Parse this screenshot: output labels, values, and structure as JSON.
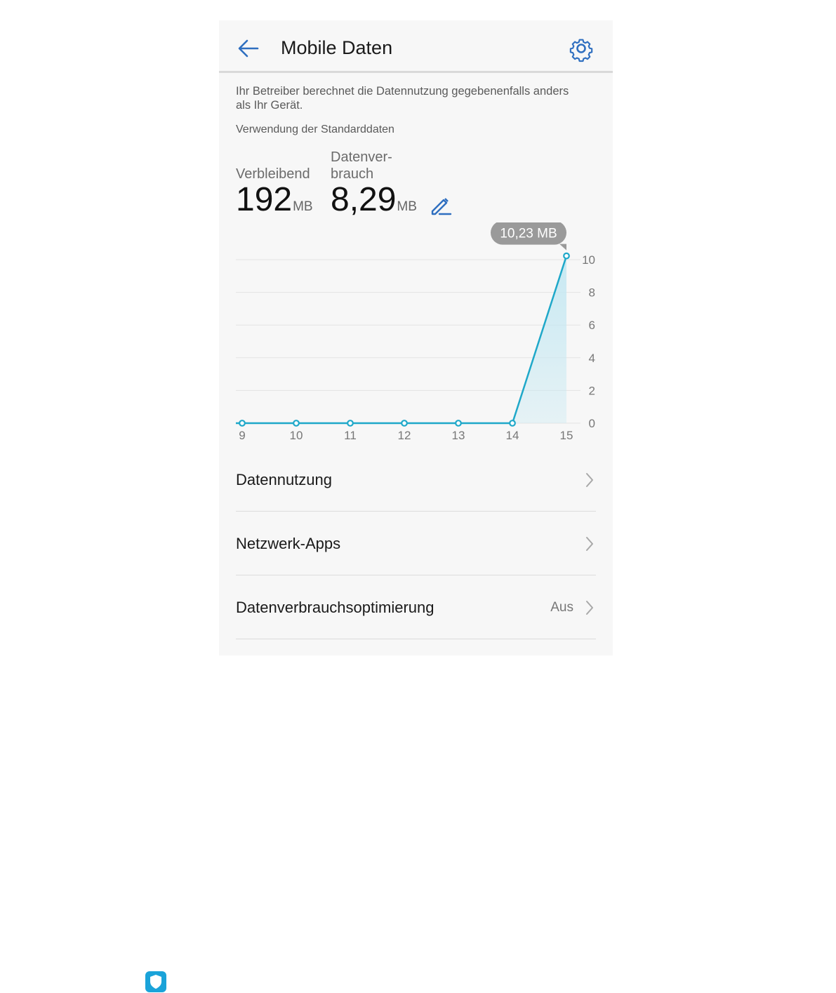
{
  "header": {
    "title": "Mobile Daten",
    "back_icon": "arrow-left-icon",
    "settings_icon": "gear-icon",
    "accent_color": "#2f6fc0"
  },
  "notice": {
    "text": "Ihr Betreiber berechnet die Datennutzung gegebenenfalls anders als Ihr Gerät.",
    "subtitle": "Verwendung der Standarddaten"
  },
  "stats": {
    "remaining_label": "Verbleibend",
    "remaining_value": "192",
    "remaining_unit": "MB",
    "usage_label_line1": "Datenver-",
    "usage_label_line2": "brauch",
    "usage_value": "8,29",
    "usage_unit": "MB",
    "edit_icon": "pencil-edit-icon"
  },
  "chart_data": {
    "type": "area",
    "x": [
      "9",
      "10",
      "11",
      "12",
      "13",
      "14",
      "15"
    ],
    "values": [
      0,
      0,
      0,
      0,
      0,
      0,
      10.23
    ],
    "ylim": [
      0,
      10
    ],
    "yticks": [
      "0",
      "2",
      "4",
      "6",
      "8",
      "10"
    ],
    "y_axis_position": "right",
    "grid": true,
    "tooltip": "10,23 MB",
    "line_color": "#1fa8c9",
    "fill_color": "#c5e8f2"
  },
  "list": [
    {
      "label": "Datennutzung",
      "value": ""
    },
    {
      "label": "Netzwerk-Apps",
      "value": ""
    },
    {
      "label": "Datenverbrauchsoptimierung",
      "value": "Aus"
    }
  ],
  "taskbar": {
    "icon": "shield-app-icon"
  }
}
